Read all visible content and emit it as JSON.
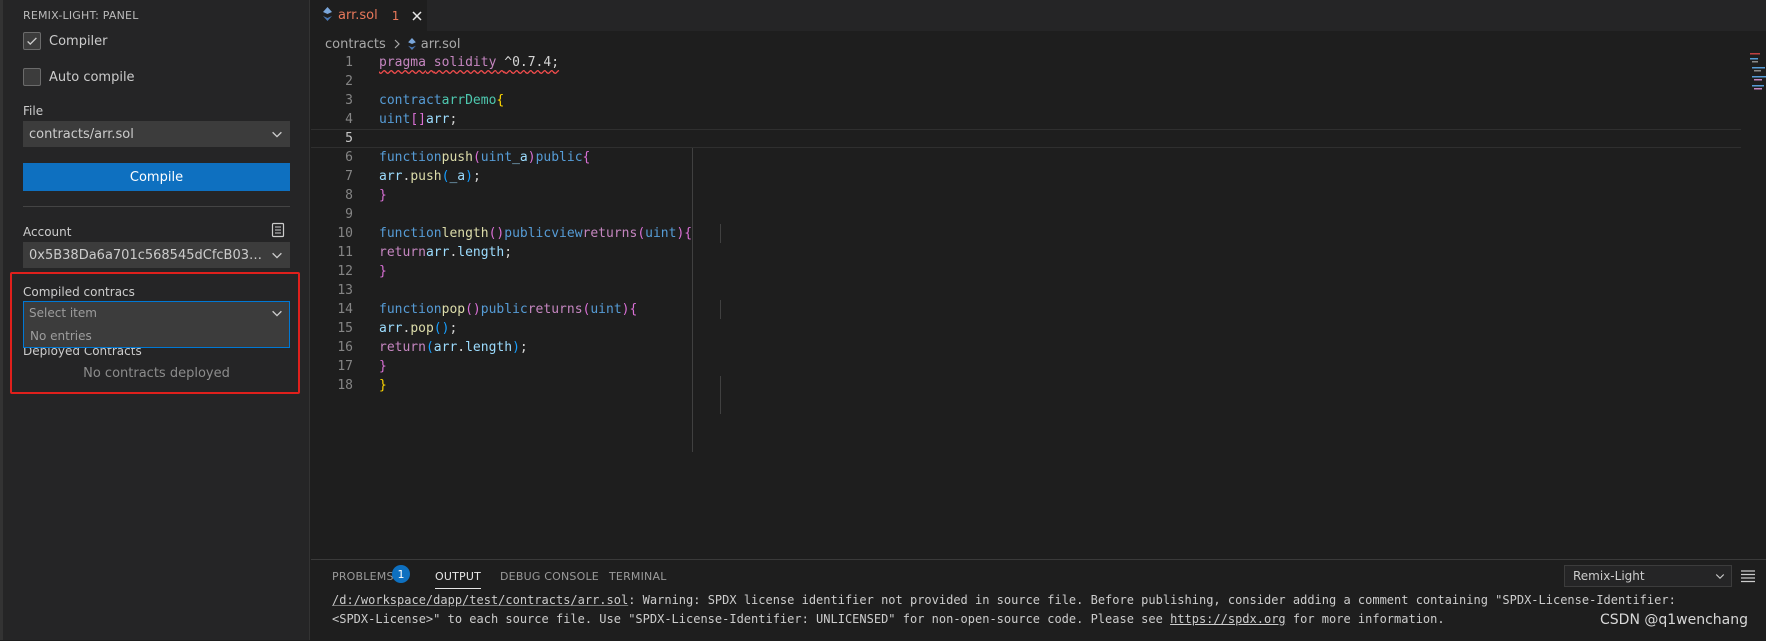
{
  "sidebar": {
    "panel_title": "REMIX-LIGHT: PANEL",
    "compiler_label": "Compiler",
    "compiler_checked": true,
    "auto_compile_label": "Auto compile",
    "auto_compile_checked": false,
    "file_label": "File",
    "file_value": "contracts/arr.sol",
    "compile_button": "Compile",
    "account_label": "Account",
    "account_value": "0x5B38Da6a701c568545dCfcB03FcB875...",
    "compiled_label": "Compiled contracs",
    "compiled_placeholder": "Select item",
    "compiled_no_entries": "No entries",
    "deployed_label": "Deployed Contracts",
    "deployed_empty": "No contracts deployed"
  },
  "editor": {
    "tab_name": "arr.sol",
    "tab_problem_count": "1",
    "breadcrumb": [
      "contracts",
      "arr.sol"
    ],
    "line_numbers": [
      "1",
      "2",
      "3",
      "4",
      "5",
      "6",
      "7",
      "8",
      "9",
      "10",
      "11",
      "12",
      "13",
      "14",
      "15",
      "16",
      "17",
      "18"
    ]
  },
  "panel": {
    "tabs": [
      "PROBLEMS",
      "OUTPUT",
      "DEBUG CONSOLE",
      "TERMINAL"
    ],
    "problems_badge": "1",
    "active_tab": "OUTPUT",
    "output_channel": "Remix-Light",
    "output_line1_path": "/d:/workspace/dapp/test/contracts/arr.sol",
    "output_line1_rest": ": Warning: SPDX license identifier not provided in source file. Before publishing, consider adding a comment containing \"SPDX-License-Identifier:",
    "output_line2_start": "<SPDX-License>\" to each source file. Use \"SPDX-License-Identifier: UNLICENSED\" for non-open-source code. Please see ",
    "output_line2_link": "https://spdx.org",
    "output_line2_end": " for more information."
  },
  "watermark": "CSDN @q1wenchang",
  "colors": {
    "accent": "#0e70c0",
    "highlight_box": "#e0201c",
    "tab_error_text": "#e8785b"
  }
}
